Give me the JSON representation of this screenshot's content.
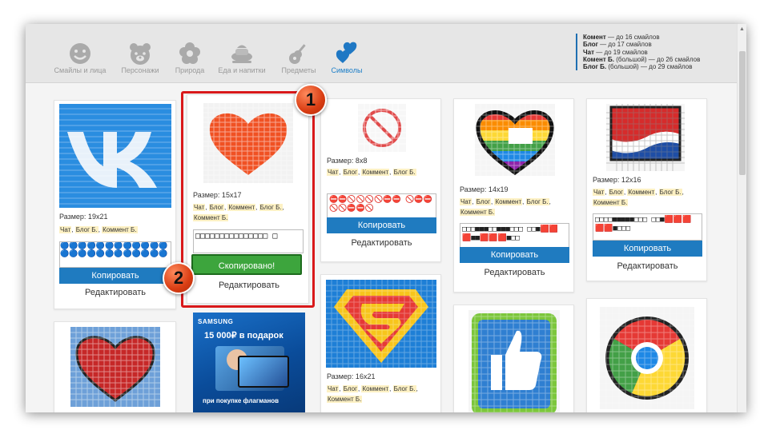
{
  "categories": [
    {
      "label": "Смайлы и лица",
      "icon": "smiley-icon"
    },
    {
      "label": "Персонажи",
      "icon": "bear-face-icon"
    },
    {
      "label": "Природа",
      "icon": "flower-icon"
    },
    {
      "label": "Еда и напитки",
      "icon": "food-icon"
    },
    {
      "label": "Предметы",
      "icon": "guitar-icon"
    },
    {
      "label": "Символы",
      "icon": "hearts-icon",
      "active": true
    }
  ],
  "legend": [
    {
      "name": "Комент",
      "text": " — до 16 смайлов"
    },
    {
      "name": "Блог",
      "text": " — до 17 смайлов"
    },
    {
      "name": "Чат",
      "text": " — до 19 смайлов"
    },
    {
      "name": "Комент Б.",
      "text": " (большой) — до 26 смайлов"
    },
    {
      "name": "Блог Б.",
      "text": " (большой) — до 29 смайлов"
    }
  ],
  "cards": {
    "vk": {
      "size": "Размер: 19х21",
      "tags": [
        "Чат",
        "Блог Б.",
        "Коммент Б."
      ],
      "preview": "🔵🔵🔵🔵🔵🔵🔵🔵🔵🔵🔵🔵 🔵🔵🔵🔵🔵🔵🔵🔵🔵🔵🔵🔵",
      "copy": "Копировать",
      "edit": "Редактировать"
    },
    "heart": {
      "size": "Размер: 15х17",
      "tags": [
        "Чат",
        "Блог",
        "Коммент",
        "Блог Б.",
        "Коммент Б."
      ],
      "preview": "□□□□□□□□□□□□□□□ □",
      "copied": "Скопировано!",
      "edit": "Редактировать"
    },
    "noentry": {
      "size": "Размер: 8х8",
      "tags": [
        "Чат",
        "Блог",
        "Коммент",
        "Блог Б."
      ],
      "preview": "⛔⛔🚫🚫🚫🚫⛔⛔ 🚫⛔⛔🚫🚫⛔⛔🚫",
      "copy": "Копировать",
      "edit": "Редактировать"
    },
    "rainbow": {
      "size": "Размер: 14х19",
      "tags": [
        "Чат",
        "Блог",
        "Коммент",
        "Блог Б.",
        "Коммент Б."
      ],
      "preview": "□□□■■■□□■■■□□□ □□■🟥🟥🟥■■🟥🟥🟥■□□",
      "copy": "Копировать",
      "edit": "Редактировать"
    },
    "pepsi": {
      "size": "Размер: 12х16",
      "tags": [
        "Чат",
        "Блог",
        "Коммент",
        "Блог Б.",
        "Коммент Б."
      ],
      "preview": "□□□□■■■■■□□□ □□■🟥🟥🟥🟥🟥■□□□",
      "copy": "Копировать",
      "edit": "Редактировать"
    },
    "superman": {
      "size": "Размер: 16х21",
      "tags": [
        "Чат",
        "Блог",
        "Коммент",
        "Блог Б.",
        "Коммент Б."
      ]
    }
  },
  "ad": {
    "brand": "SAMSUNG",
    "promo": "15 000₽ в подарок",
    "footer": "при покупке флагманов"
  },
  "annotations": {
    "badge1": "1",
    "badge2": "2"
  },
  "colors": {
    "accent": "#1f7bc0",
    "success": "#3da53d",
    "highlight": "#d9191b",
    "tag": "#fdf1c4"
  }
}
